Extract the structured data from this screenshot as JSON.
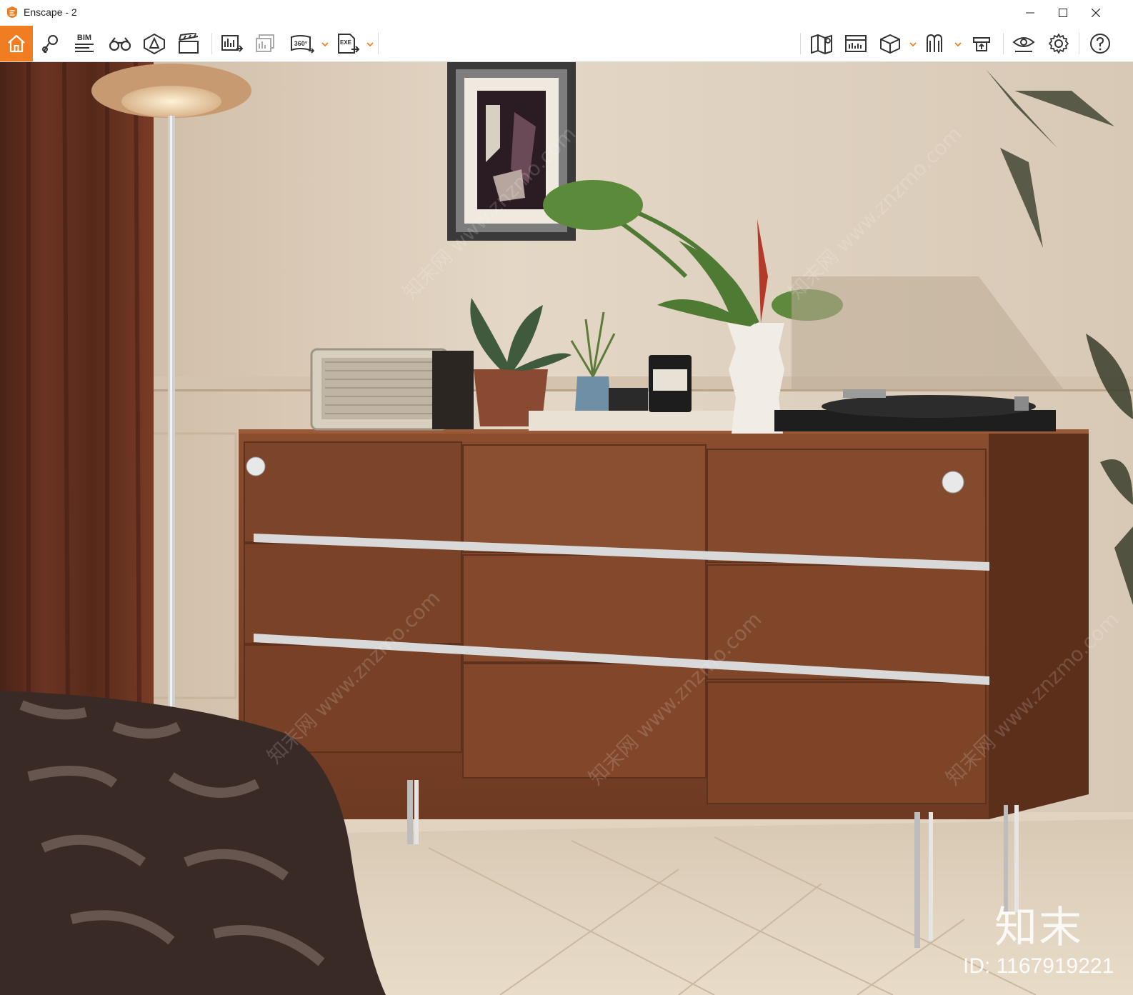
{
  "window": {
    "title": "Enscape - 2",
    "accent_color": "#f07d22",
    "controls": [
      "minimize-icon",
      "maximize-icon",
      "close-icon"
    ]
  },
  "toolbar": {
    "left_tools": [
      {
        "name": "home",
        "icon": "home-icon",
        "active": true
      },
      {
        "name": "views",
        "icon": "map-pin-icon"
      },
      {
        "name": "bim",
        "icon": "bim-icon",
        "label": "BIM"
      },
      {
        "name": "walk-mode",
        "icon": "binoculars-icon"
      },
      {
        "name": "asset-library",
        "icon": "asset-library-icon"
      },
      {
        "name": "video-editor",
        "icon": "clapperboard-icon"
      },
      {
        "name": "screenshot",
        "icon": "render-image-icon"
      },
      {
        "name": "batch-render",
        "icon": "batch-render-icon"
      },
      {
        "name": "panorama",
        "icon": "panorama-360-icon",
        "label": "360°"
      },
      {
        "name": "export-exe",
        "icon": "export-exe-icon",
        "label": "EXE"
      }
    ],
    "right_tools": [
      {
        "name": "map",
        "icon": "map-icon"
      },
      {
        "name": "info-panel",
        "icon": "info-panel-icon"
      },
      {
        "name": "section-box",
        "icon": "cube-icon"
      },
      {
        "name": "material-editor",
        "icon": "material-icon"
      },
      {
        "name": "upload",
        "icon": "upload-icon"
      },
      {
        "name": "visual-settings",
        "icon": "eye-settings-icon"
      },
      {
        "name": "settings",
        "icon": "gear-icon"
      },
      {
        "name": "help",
        "icon": "help-icon"
      }
    ]
  },
  "viewport": {
    "scene": "bedroom dresser render",
    "watermark": {
      "logo": "知末",
      "id_text": "ID: 1167919221",
      "diagonal": "知末网 www.znzmo.com"
    }
  }
}
